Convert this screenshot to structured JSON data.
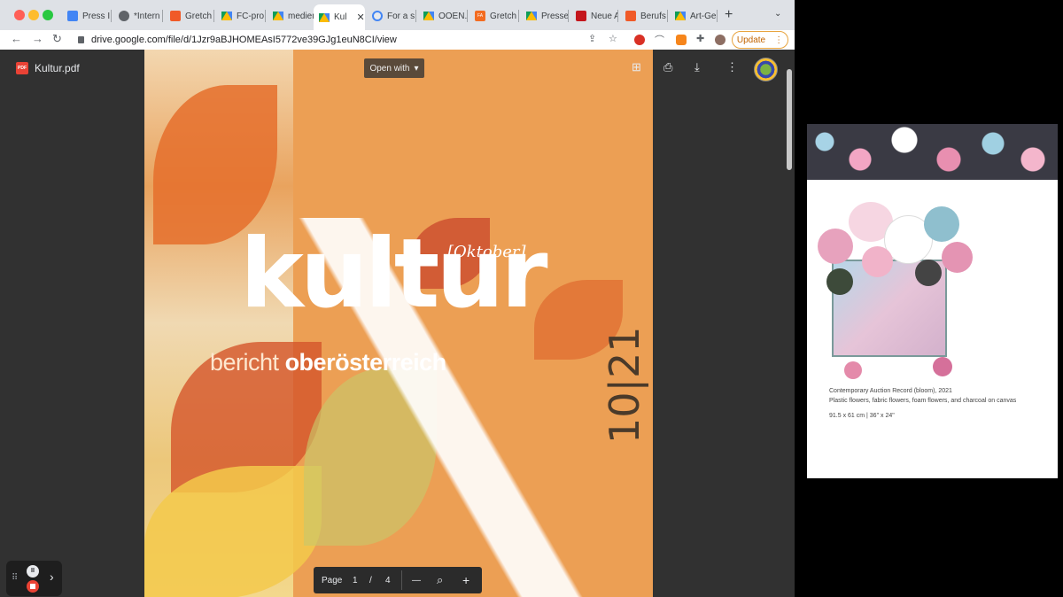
{
  "browser": {
    "tabs": [
      {
        "label": "Press I",
        "icon": "google-docs-icon"
      },
      {
        "label": "*Intern",
        "icon": "globe-icon"
      },
      {
        "label": "Gretch",
        "icon": "orange-square-icon"
      },
      {
        "label": "FC-pro",
        "icon": "google-drive-icon"
      },
      {
        "label": "medien",
        "icon": "google-drive-icon"
      },
      {
        "label": "Kul",
        "icon": "google-drive-icon",
        "active": true,
        "close": "✕"
      },
      {
        "label": "For a s",
        "icon": "bloom-icon"
      },
      {
        "label": "OOEN.",
        "icon": "google-drive-icon"
      },
      {
        "label": "Gretch",
        "icon": "fa-icon"
      },
      {
        "label": "Presse",
        "icon": "google-drive-icon"
      },
      {
        "label": "Neue A",
        "icon": "news-icon"
      },
      {
        "label": "Berufs",
        "icon": "orange-square-icon"
      },
      {
        "label": "Art-Ge",
        "icon": "google-drive-icon"
      }
    ],
    "new_tab": "+",
    "url": "drive.google.com/file/d/1Jzr9aBJHOMEAsI5772ve39GJg1euN8CI/view",
    "update_label": "Update"
  },
  "viewer": {
    "file_name": "Kultur.pdf",
    "open_with_label": "Open with",
    "pager": {
      "label": "Page",
      "current": "1",
      "separator": "/",
      "total": "4",
      "zoom_out": "—",
      "zoom_in": "+"
    }
  },
  "document": {
    "title": "kultur",
    "month": "[Oktober]",
    "subtitle_light": "bericht",
    "subtitle_bold": "oberösterreich",
    "issue": "10|21"
  },
  "side_panel": {
    "caption_line1": "Contemporary Auction Record (bloom), 2021",
    "caption_line2": "Plastic flowers, fabric flowers, foam flowers, and charcoal on canvas",
    "dimensions": "91.5 x 61 cm  |  36\" x 24\""
  },
  "colors": {
    "viewer_bg": "#313131",
    "page_orange": "#ec9f54",
    "update_accent": "#c26401"
  }
}
